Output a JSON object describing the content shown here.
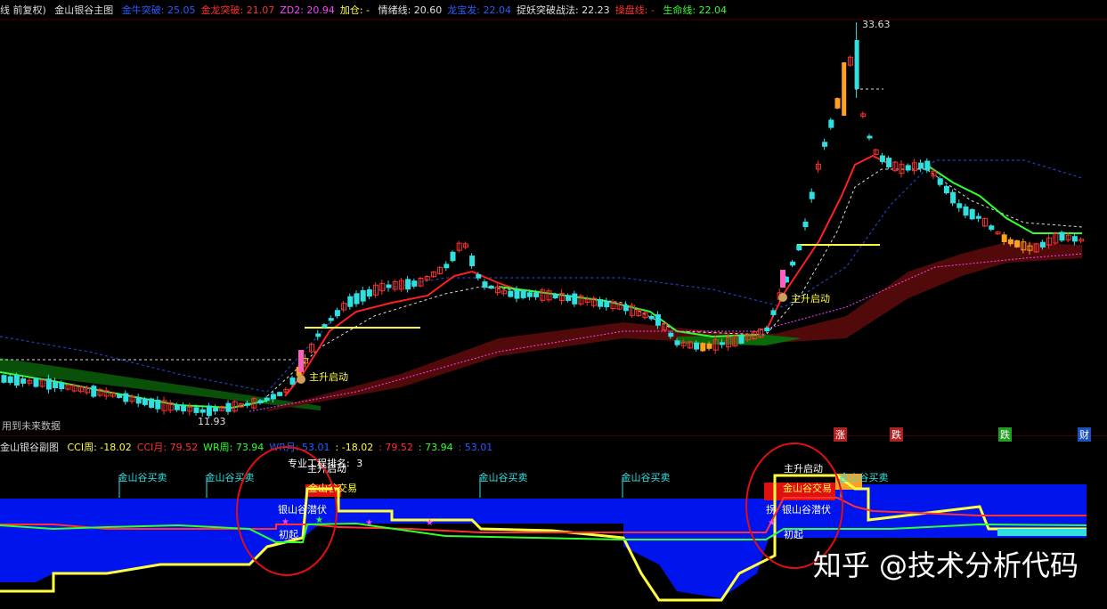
{
  "main_header": {
    "prefix": "线 前复权)",
    "title": "金山银谷主图",
    "items": [
      {
        "label": "金牛突破:",
        "value": "25.05",
        "color": "#2a5cff"
      },
      {
        "label": "金龙突破:",
        "value": "21.07",
        "color": "#ff3030"
      },
      {
        "label": "ZD2:",
        "value": "20.94",
        "color": "#ff40ff"
      },
      {
        "label": "加仓: -",
        "value": "",
        "color": "#ffff40"
      },
      {
        "label": "情绪线:",
        "value": "20.60",
        "color": "#e0e0e0"
      },
      {
        "label": "龙宝发:",
        "value": "22.04",
        "color": "#2a5cff"
      },
      {
        "label": "捉妖突破战法:",
        "value": "22.23",
        "color": "#e0e0e0"
      },
      {
        "label": "操盘线: -",
        "value": "",
        "color": "#ff3030"
      },
      {
        "label": "生命线:",
        "value": "22.04",
        "color": "#30ff30"
      }
    ]
  },
  "main_chart": {
    "high_label": "33.63",
    "low_label": "11.93",
    "annotation_1": "主升启动",
    "annotation_2": "主升启动",
    "future_note": "用到未来数据",
    "bottom_tags": [
      {
        "text": "涨",
        "color": "#b02020"
      },
      {
        "text": "跌",
        "color": "#b02020"
      },
      {
        "text": "跌",
        "color": "#20a020"
      },
      {
        "text": "财",
        "color": "#2050c0"
      }
    ]
  },
  "sub_header": {
    "title": "金山银谷副图",
    "items": [
      {
        "label": "CCI周:",
        "value": "-18.02",
        "color": "#ffff40"
      },
      {
        "label": "CCI月:",
        "value": "79.52",
        "color": "#ff3030"
      },
      {
        "label": "WR周:",
        "value": "73.94",
        "color": "#30ff30"
      },
      {
        "label": "WR月:",
        "value": "53.01",
        "color": "#2a5cff"
      },
      {
        "label": ":",
        "value": "-18.02",
        "color": "#ffff40"
      },
      {
        "label": ":",
        "value": "79.52",
        "color": "#ff3030"
      },
      {
        "label": ":",
        "value": "73.94",
        "color": "#30ff30"
      },
      {
        "label": ":",
        "value": "53.01",
        "color": "#2a5cff"
      }
    ]
  },
  "sub_chart": {
    "buy_label": "金山谷买卖",
    "rank_label": "专业工程排名:",
    "rank_value": "3",
    "labels": [
      "主升启动",
      "金山谷交易",
      "银山谷潜伏",
      "初起",
      "主升启动",
      "金山谷交易",
      "银山谷潜伏",
      "初起",
      "拐"
    ]
  },
  "watermark": "知乎 @技术分析代码",
  "colors": {
    "bg": "#000000",
    "up": "#ff3030",
    "down": "#30e0e0",
    "yellow": "#ffff40",
    "blue_fill": "#0018ff",
    "cloud_red": "#5a0a0a",
    "cloud_green": "#0a6a0a"
  }
}
